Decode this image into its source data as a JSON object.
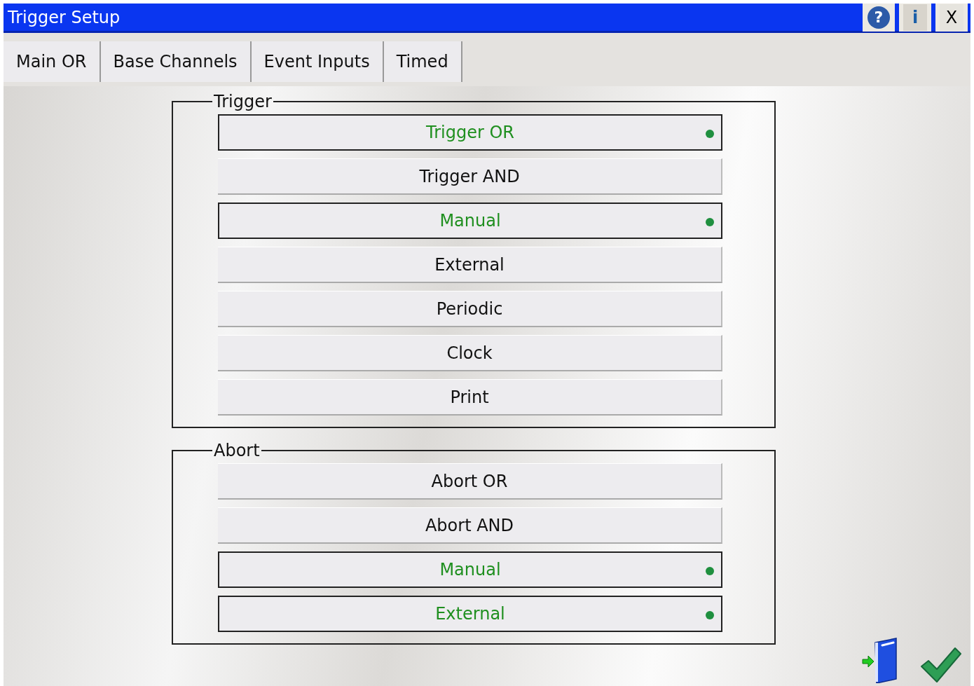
{
  "window": {
    "title": "Trigger Setup",
    "controls": [
      "?",
      "i",
      "X"
    ]
  },
  "tabs": [
    {
      "label": "Main OR"
    },
    {
      "label": "Base Channels"
    },
    {
      "label": "Event Inputs"
    },
    {
      "label": "Timed"
    }
  ],
  "groups": [
    {
      "title": "Trigger",
      "options": [
        {
          "label": "Trigger OR",
          "on": true
        },
        {
          "label": "Trigger AND",
          "on": false
        },
        {
          "label": "Manual",
          "on": true
        },
        {
          "label": "External",
          "on": false
        },
        {
          "label": "Periodic",
          "on": false
        },
        {
          "label": "Clock",
          "on": false
        },
        {
          "label": "Print",
          "on": false
        }
      ]
    },
    {
      "title": "Abort",
      "options": [
        {
          "label": "Abort OR",
          "on": false
        },
        {
          "label": "Abort AND",
          "on": false
        },
        {
          "label": "Manual",
          "on": true
        },
        {
          "label": "External",
          "on": true
        }
      ]
    }
  ]
}
